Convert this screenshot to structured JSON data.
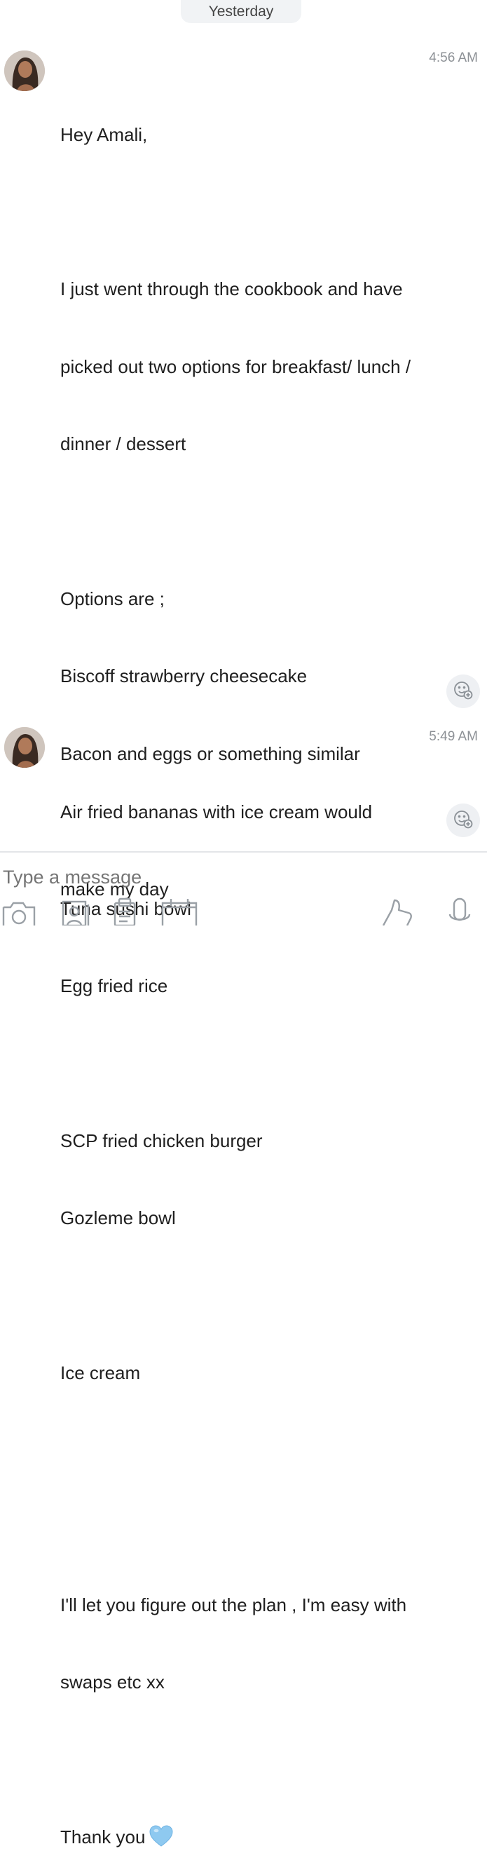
{
  "date_divider": "Yesterday",
  "messages": [
    {
      "sender_name": "",
      "time": "4:56 AM",
      "lines": [
        "Hey Amali,",
        "",
        "I just went through the cookbook and have",
        "picked out two options for breakfast/ lunch /",
        "dinner / dessert",
        "",
        "Options are ;",
        "Biscoff strawberry cheesecake",
        "Bacon and eggs or something similar",
        "",
        "Tuna sushi bowl",
        "Egg fried rice",
        "",
        "SCP fried chicken burger",
        "Gozleme bowl",
        "",
        "Ice cream",
        "",
        "",
        "I'll let you figure out the plan , I'm easy with",
        "swaps etc xx",
        "",
        "Thank you"
      ],
      "emoji": "light-blue-heart"
    },
    {
      "sender_name": "",
      "time": "5:49 AM",
      "lines": [
        "Air fried bananas with ice cream would",
        "make my day"
      ]
    }
  ],
  "composer": {
    "placeholder": "Type a message",
    "icons": [
      "camera-icon",
      "contact-icon",
      "document-icon",
      "calendar-icon",
      "thumbs-up-icon",
      "microphone-icon"
    ]
  },
  "colors": {
    "heart": "#8ec9f0",
    "icon_gray": "#9aa0a6",
    "timestamp": "#8d9196"
  }
}
